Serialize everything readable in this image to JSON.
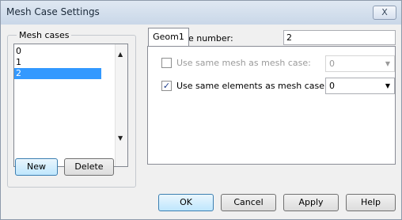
{
  "window": {
    "title": "Mesh Case Settings",
    "close_glyph": "X"
  },
  "mesh_cases": {
    "title": "Mesh cases",
    "items": [
      {
        "label": "0",
        "selected": false
      },
      {
        "label": "1",
        "selected": false
      },
      {
        "label": "2",
        "selected": true
      }
    ],
    "new_label": "New",
    "delete_label": "Delete"
  },
  "mesh_case_number": {
    "label": "Mesh case number:",
    "value": "2"
  },
  "tabs": [
    {
      "label": "Geom1",
      "active": true
    }
  ],
  "options": {
    "same_mesh": {
      "label": "Use same mesh as mesh case:",
      "checked": false,
      "value": "0",
      "enabled": false
    },
    "same_elements": {
      "label": "Use same elements as mesh case:",
      "checked": true,
      "value": "0",
      "enabled": true
    }
  },
  "footer": {
    "ok": "OK",
    "cancel": "Cancel",
    "apply": "Apply",
    "help": "Help"
  },
  "icons": {
    "close": "close-icon",
    "scroll_up": "arrow-up-icon",
    "scroll_down": "arrow-down-icon",
    "dropdown": "chevron-down-icon",
    "check": "checkmark-icon"
  },
  "colors": {
    "selection": "#3399ff",
    "titlebar": "#c9d7e8",
    "check": "#1b3c8a"
  }
}
